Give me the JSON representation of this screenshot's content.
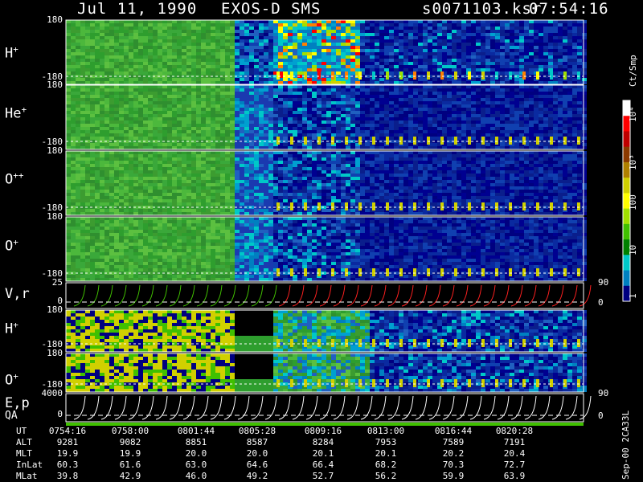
{
  "header": {
    "date": "Jul 11, 1990",
    "instrument": "EXOS-D SMS",
    "file": "s0071103.ksr",
    "time": "07:54:16"
  },
  "panels": [
    {
      "name": "H",
      "sup": "+",
      "top": "180",
      "bottom": "-180"
    },
    {
      "name": "He",
      "sup": "+",
      "top": "180",
      "bottom": "-180"
    },
    {
      "name": "O",
      "sup": "++",
      "top": "180",
      "bottom": "-180"
    },
    {
      "name": "O",
      "sup": "+",
      "top": "180",
      "bottom": "-180"
    },
    {
      "name": "V,r",
      "sup": "",
      "top": "25",
      "bottom": "0",
      "right": "90",
      "rbottom": "0"
    },
    {
      "name": "H",
      "sup": "+",
      "top": "180",
      "bottom": "-180"
    },
    {
      "name": "O",
      "sup": "+",
      "top": "180",
      "bottom": "-180"
    },
    {
      "name": "E,p",
      "sup": "",
      "top": "4000",
      "bottom": "0",
      "right": "90",
      "rbottom": "0"
    }
  ],
  "qa_label": "QA",
  "colorbar": {
    "unit": "Ct/Smp",
    "labels": [
      "10⁴",
      "10³",
      "100",
      "10",
      "1"
    ],
    "colors": [
      "#ffffff",
      "#ff0000",
      "#c00000",
      "#8b3a00",
      "#b08000",
      "#d0d000",
      "#ffff00",
      "#a0e000",
      "#40c000",
      "#008000",
      "#00c8c8",
      "#0080c0",
      "#000080"
    ]
  },
  "ephemeris": {
    "rows": [
      {
        "label": "UT",
        "values": [
          "0754:16",
          "0758:00",
          "0801:44",
          "0805:28",
          "0809:16",
          "0813:00",
          "0816:44",
          "0820:28"
        ]
      },
      {
        "label": "ALT",
        "values": [
          "9281",
          "9082",
          "8851",
          "8587",
          "8284",
          "7953",
          "7589",
          "7191"
        ]
      },
      {
        "label": "MLT",
        "values": [
          "19.9",
          "19.9",
          "20.0",
          "20.0",
          "20.1",
          "20.1",
          "20.2",
          "20.4"
        ]
      },
      {
        "label": "InLat",
        "values": [
          "60.3",
          "61.6",
          "63.0",
          "64.6",
          "66.4",
          "68.2",
          "70.3",
          "72.7"
        ]
      },
      {
        "label": "MLat",
        "values": [
          "39.8",
          "42.9",
          "46.0",
          "49.2",
          "52.7",
          "56.2",
          "59.9",
          "63.9"
        ]
      }
    ]
  },
  "footer_id": "Sep-00 2CA33L"
}
